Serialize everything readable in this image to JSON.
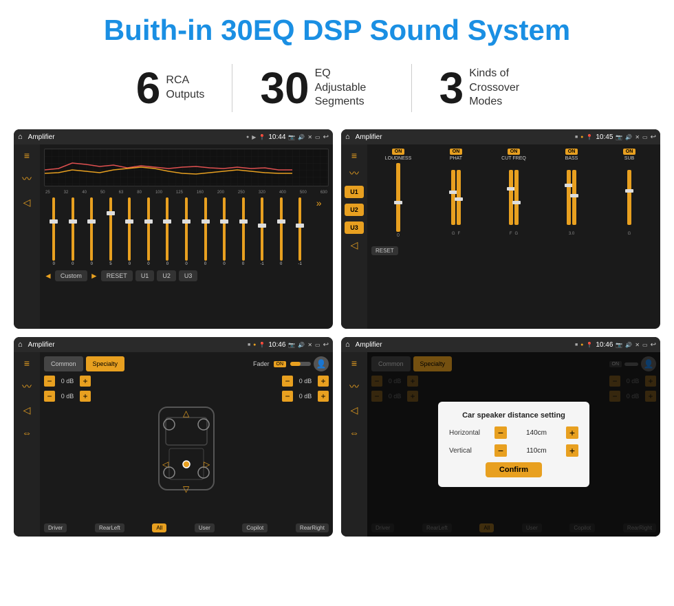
{
  "page": {
    "title": "Buith-in 30EQ DSP Sound System",
    "stats": [
      {
        "number": "6",
        "text": "RCA\nOutputs"
      },
      {
        "number": "30",
        "text": "EQ Adjustable\nSegments"
      },
      {
        "number": "3",
        "text": "Kinds of\nCrossover Modes"
      }
    ],
    "screens": [
      {
        "id": "screen1",
        "topbar": {
          "title": "Amplifier",
          "time": "10:44"
        },
        "type": "eq",
        "freqs": [
          "25",
          "32",
          "40",
          "50",
          "63",
          "80",
          "100",
          "125",
          "160",
          "200",
          "250",
          "320",
          "400",
          "500",
          "630"
        ],
        "vals": [
          "0",
          "0",
          "0",
          "5",
          "0",
          "0",
          "0",
          "0",
          "0",
          "0",
          "0",
          "-1",
          "0",
          "-1",
          ""
        ],
        "buttons": [
          "Custom",
          "RESET",
          "U1",
          "U2",
          "U3"
        ]
      },
      {
        "id": "screen2",
        "topbar": {
          "title": "Amplifier",
          "time": "10:45"
        },
        "type": "crossover",
        "uButtons": [
          "U1",
          "U2",
          "U3"
        ],
        "cols": [
          {
            "on": true,
            "label": "LOUDNESS"
          },
          {
            "on": true,
            "label": "PHAT"
          },
          {
            "on": true,
            "label": "CUT FREQ"
          },
          {
            "on": true,
            "label": "BASS"
          },
          {
            "on": true,
            "label": "SUB"
          }
        ],
        "resetLabel": "RESET"
      },
      {
        "id": "screen3",
        "topbar": {
          "title": "Amplifier",
          "time": "10:46"
        },
        "type": "fader",
        "tabs": [
          "Common",
          "Specialty"
        ],
        "activeTab": 1,
        "faderLabel": "Fader",
        "faderOn": "ON",
        "dbRows": [
          {
            "val": "0 dB"
          },
          {
            "val": "0 dB"
          },
          {
            "val": "0 dB"
          },
          {
            "val": "0 dB"
          }
        ],
        "bottomLabels": [
          "Driver",
          "",
          "Copilot",
          "RearLeft",
          "All",
          "User",
          "RearRight"
        ]
      },
      {
        "id": "screen4",
        "topbar": {
          "title": "Amplifier",
          "time": "10:46"
        },
        "type": "distance",
        "tabs": [
          "Common",
          "Specialty"
        ],
        "dialog": {
          "title": "Car speaker distance setting",
          "rows": [
            {
              "label": "Horizontal",
              "value": "140cm"
            },
            {
              "label": "Vertical",
              "value": "110cm"
            }
          ],
          "confirmLabel": "Confirm"
        },
        "bottomLabels": [
          "Driver",
          "",
          "Copilot",
          "RearLeft",
          "All",
          "User",
          "RearRight"
        ]
      }
    ]
  }
}
